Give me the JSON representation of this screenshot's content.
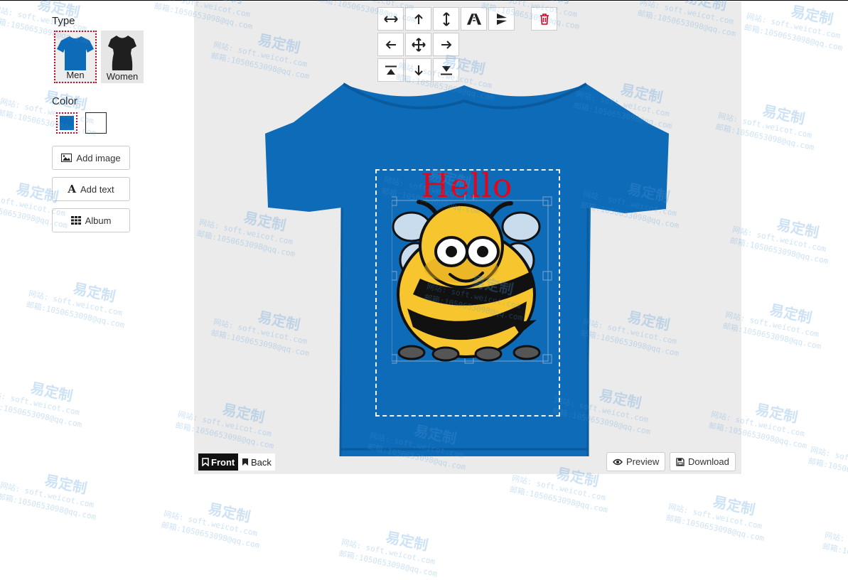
{
  "panel": {
    "type_label": "Type",
    "types": [
      {
        "label": "Men",
        "selected": true,
        "color": "#0e6bb7"
      },
      {
        "label": "Women",
        "selected": false,
        "color": "#1f1f1f"
      }
    ],
    "color_label": "Color",
    "colors": [
      {
        "name": "blue",
        "hex": "#0e6bb7",
        "selected": true
      },
      {
        "name": "white",
        "hex": "#ffffff",
        "selected": false
      }
    ],
    "add_image_label": "Add image",
    "add_text_label": "Add text",
    "album_label": "Album"
  },
  "toolbar": {
    "tools": [
      {
        "name": "stretch-horizontal-icon"
      },
      {
        "name": "arrow-up-icon"
      },
      {
        "name": "stretch-vertical-icon"
      },
      {
        "name": "flip-horizontal-icon"
      },
      {
        "name": "flip-vertical-icon"
      },
      {
        "name": "arrow-left-icon"
      },
      {
        "name": "move-center-icon"
      },
      {
        "name": "arrow-right-icon"
      },
      {
        "name": "align-top-icon"
      },
      {
        "name": "arrow-down-icon"
      },
      {
        "name": "align-bottom-icon"
      }
    ],
    "delete_icon": "trash-icon",
    "delete_color": "#d0021b"
  },
  "canvas": {
    "design_text": "Hello",
    "text_color": "#e3051b",
    "shirt_color": "#0e6bb7"
  },
  "sides": {
    "front_label": "Front",
    "back_label": "Back",
    "active": "front"
  },
  "actions": {
    "preview_label": "Preview",
    "download_label": "Download"
  },
  "watermark": {
    "brand": "易定制",
    "site": "网站: soft.weicot.com",
    "email": "邮箱:1050653098@qq.com"
  }
}
